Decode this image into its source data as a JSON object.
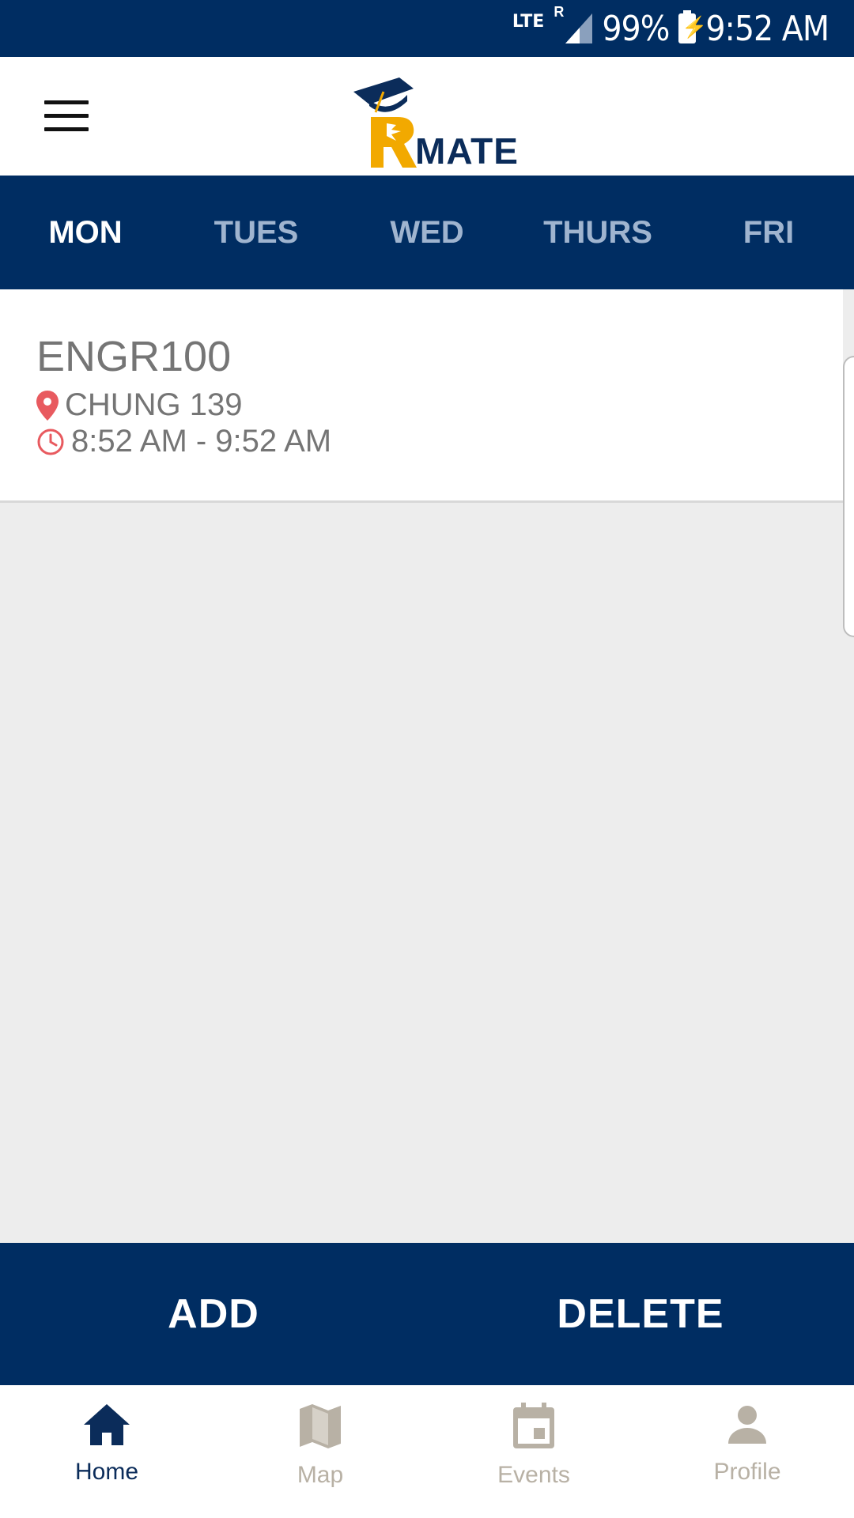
{
  "status_bar": {
    "network": "LTE",
    "roaming": "R",
    "battery": "99%",
    "time": "9:52 AM"
  },
  "header": {
    "logo_letter": "R",
    "logo_word": "MATE"
  },
  "day_tabs": [
    {
      "label": "MON",
      "active": true
    },
    {
      "label": "TUES",
      "active": false
    },
    {
      "label": "WED",
      "active": false
    },
    {
      "label": "THURS",
      "active": false
    },
    {
      "label": "FRI",
      "active": false
    }
  ],
  "class_card": {
    "course": "ENGR100",
    "location": "CHUNG 139",
    "time_range": "8:52 AM - 9:52 AM",
    "location_icon": "map-pin-icon",
    "time_icon": "clock-icon"
  },
  "actions": {
    "add_label": "ADD",
    "delete_label": "DELETE"
  },
  "bottom_nav": [
    {
      "label": "Home",
      "icon": "home-icon",
      "active": true
    },
    {
      "label": "Map",
      "icon": "map-icon",
      "active": false
    },
    {
      "label": "Events",
      "icon": "calendar-icon",
      "active": false
    },
    {
      "label": "Profile",
      "icon": "person-icon",
      "active": false
    }
  ],
  "colors": {
    "primary": "#002d62",
    "accent_red": "#e85a5f",
    "logo_gold": "#f2a900",
    "inactive_nav": "#b8b1a5"
  }
}
